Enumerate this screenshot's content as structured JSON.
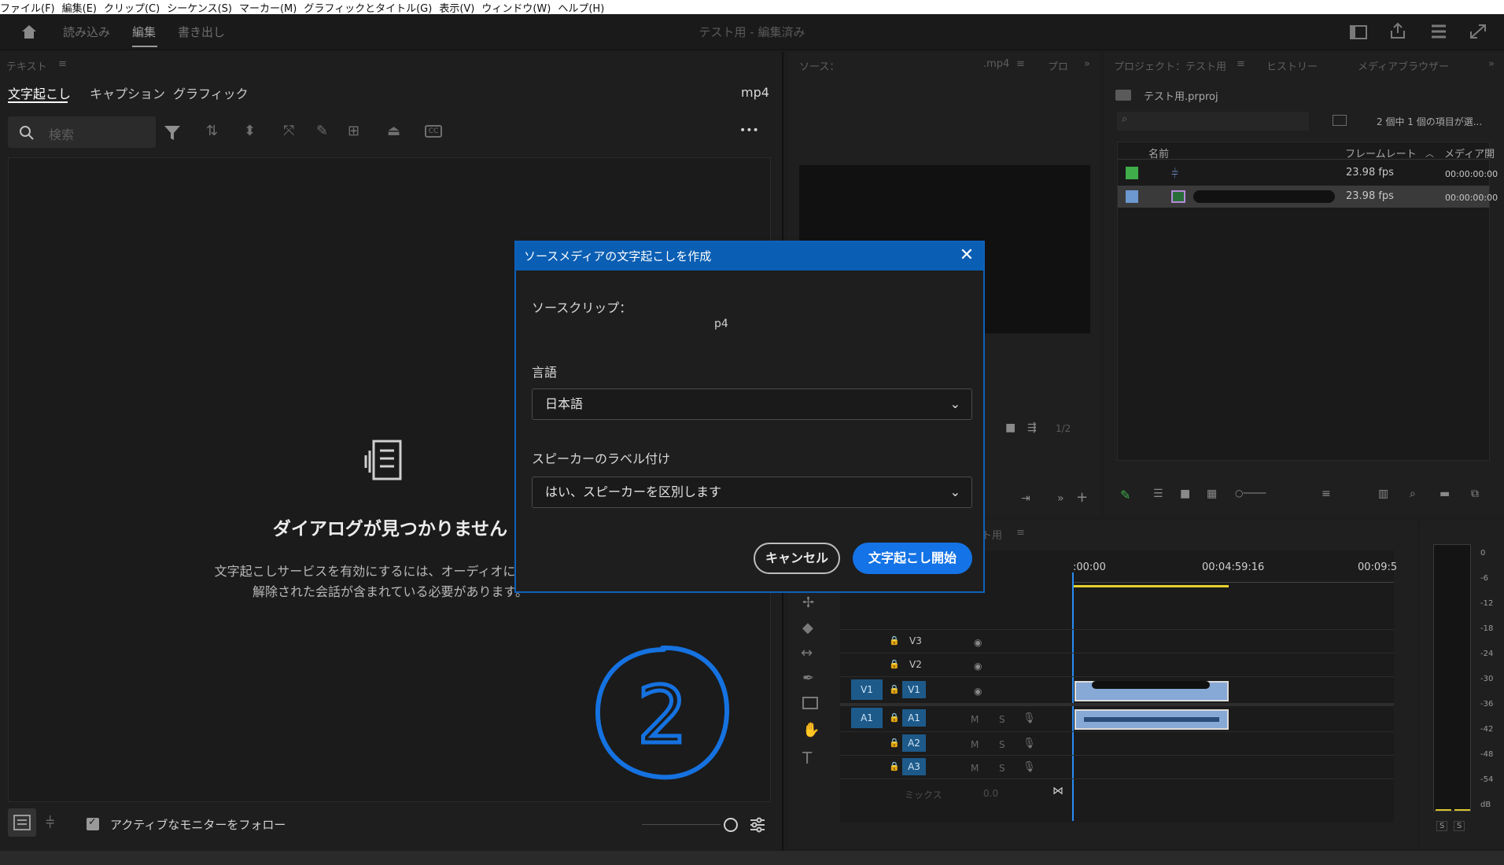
{
  "menu": [
    "ファイル(F)",
    "編集(E)",
    "クリップ(C)",
    "シーケンス(S)",
    "マーカー(M)",
    "グラフィックとタイトル(G)",
    "表示(V)",
    "ウィンドウ(W)",
    "ヘルプ(H)"
  ],
  "workspaces": {
    "import": "読み込み",
    "edit": "編集",
    "export": "書き出し"
  },
  "window_title": "テスト用 - 編集済み",
  "text_panel": {
    "title": "テキスト",
    "tabs": [
      "文字起こし",
      "キャプション",
      "グラフィック"
    ],
    "file_suffix": "mp4",
    "search_placeholder": "検索",
    "more": "•••",
    "empty_title": "ダイアログが見つかりません",
    "empty_desc_line1": "文字起こしサービスを有効にするには、オーディオにミュート",
    "empty_desc_line2": "解除された会話が含まれている必要があります。",
    "follow_monitor": "アクティブなモニターをフォロー"
  },
  "source_panel": {
    "title": "ソース：",
    "file_suffix": ".mp4",
    "tab2": "プロ",
    "page_indicator": "1/2"
  },
  "project_panel": {
    "title": "プロジェクト：テスト用",
    "tabs": [
      "ヒストリー",
      "メディアブラウザー"
    ],
    "project_file": "テスト用.prproj",
    "item_count": "2 個中 1 個の項目が選...",
    "columns": {
      "name": "名前",
      "framerate": "フレームレート",
      "media": "メディア開"
    },
    "rows": [
      {
        "fps": "23.98 fps",
        "timecode": "00:00:00:00",
        "color": "#3fae4a"
      },
      {
        "fps": "23.98 fps",
        "timecode": "00:00:00:00",
        "color": "#6d97cf"
      }
    ]
  },
  "timeline": {
    "title": "テスト用",
    "timecodes": [
      ":00:00",
      "00:04:59:16",
      "00:09:5"
    ],
    "tracks_video": [
      "V3",
      "V2",
      "V1"
    ],
    "tracks_audio": [
      "A1",
      "A2",
      "A3"
    ],
    "src_video": "V1",
    "src_audio": "A1",
    "mute": "M",
    "solo": "S",
    "mix_label": "ミックス",
    "mix_value": "0.0"
  },
  "meter": {
    "labels": [
      "0",
      "-6",
      "-12",
      "-18",
      "-24",
      "-30",
      "-36",
      "-42",
      "-48",
      "-54",
      "dB"
    ],
    "solo": "S"
  },
  "dialog": {
    "title": "ソースメディアの文字起こしを作成",
    "close": "✕",
    "source_clip_label": "ソースクリップ：",
    "source_clip_value": "p4",
    "language_label": "言語",
    "language_value": "日本語",
    "speaker_label": "スピーカーのラベル付け",
    "speaker_value": "はい、スピーカーを区別します",
    "cancel": "キャンセル",
    "start": "文字起こし開始"
  },
  "annotation": {
    "text": "2",
    "color": "#1572e0"
  }
}
